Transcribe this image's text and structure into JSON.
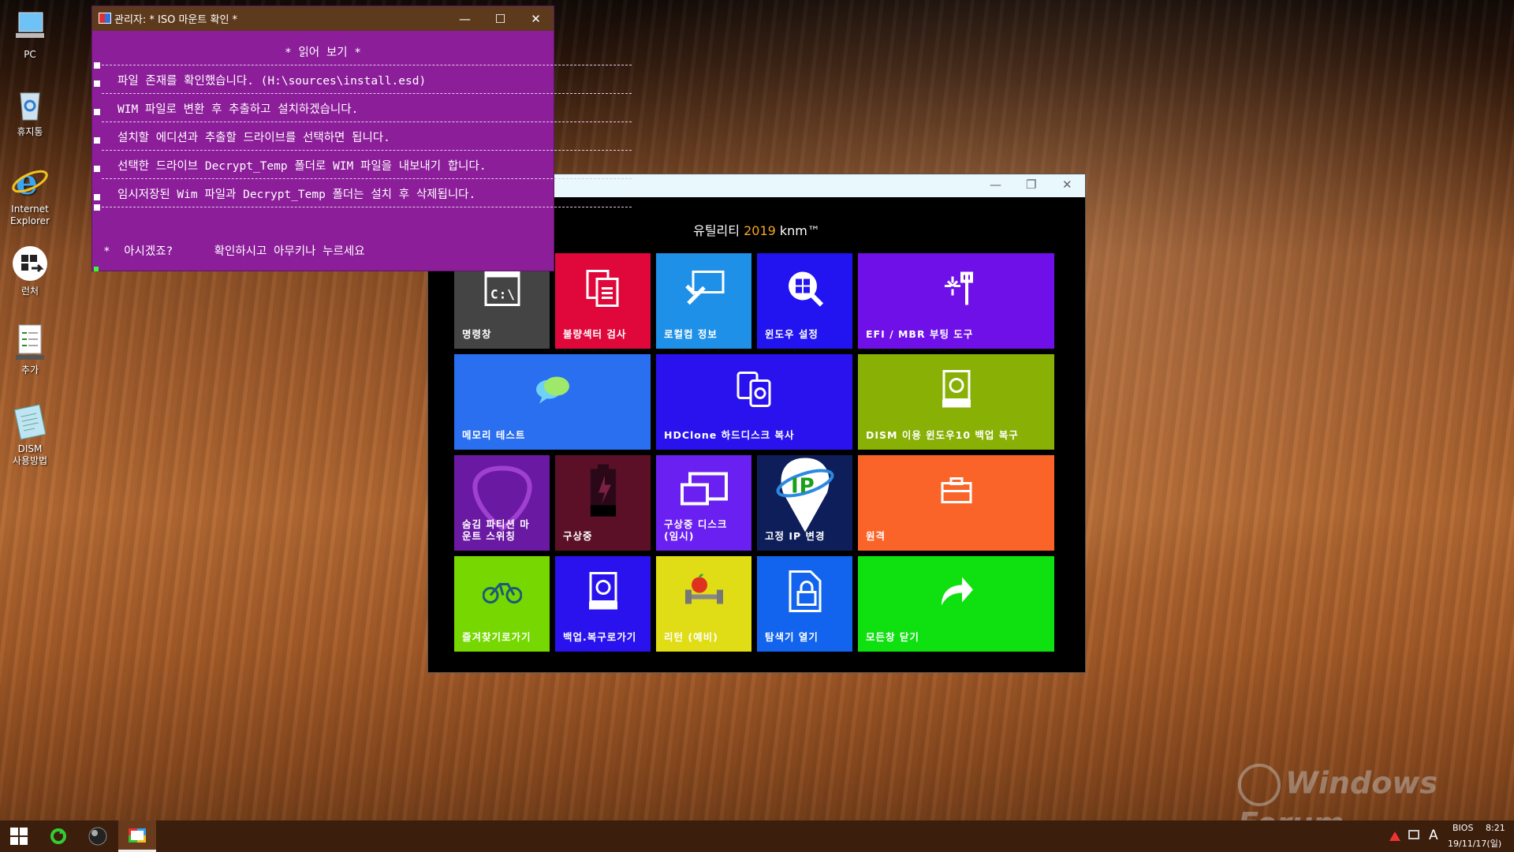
{
  "desktop": {
    "icons": [
      {
        "label": "PC",
        "icon": "pc-icon"
      },
      {
        "label": "휴지통",
        "icon": "recycle-bin-icon"
      },
      {
        "label": "Internet\nExplorer",
        "icon": "internet-explorer-icon"
      },
      {
        "label": "런처",
        "icon": "launcher-icon"
      },
      {
        "label": "추가",
        "icon": "add-document-icon"
      },
      {
        "label": "DISM\n사용방법",
        "icon": "notepad-icon"
      }
    ]
  },
  "cmd_window": {
    "title": "관리자:    * ISO 마운트 확인 *",
    "heading": "* 읽어 보기 *",
    "lines": [
      "파일 존재를 확인했습니다. (H:\\sources\\install.esd)",
      "WIM 파일로 변환 후 추출하고 설치하겠습니다.",
      "설치할 에디션과 추출할 드라이브를 선택하면 됩니다.",
      "선택한 드라이브 Decrypt_Temp 폴더로 WIM 파일을 내보내기 합니다.",
      "임시저장된 Wim 파일과 Decrypt_Temp 폴더는 설치 후 삭제됩니다."
    ],
    "prompt": "*  아시겠죠?      확인하시고 아무키나 누르세요",
    "colors": {
      "background": "#8c1e9a",
      "titlebar": "#5d3a1c"
    }
  },
  "utility_window": {
    "title_prefix": "유틸리티 ",
    "title_year": "2019",
    "title_suffix": " knm™",
    "tiles": [
      {
        "label": "명령창",
        "color": "#444444",
        "icon": "command-prompt-icon"
      },
      {
        "label": "불량섹터 검사",
        "color": "#e0083b",
        "icon": "documents-icon"
      },
      {
        "label": "로컬컴 정보",
        "color": "#1e90e8",
        "icon": "tools-monitor-icon"
      },
      {
        "label": "윈도우 설정",
        "color": "#2214f0",
        "icon": "windows-search-icon"
      },
      {
        "label": "EFI / MBR 부팅 도구",
        "color": "#7010e8",
        "icon": "wrench-spark-icon"
      },
      {
        "label": "메모리 테스트",
        "color": "#2a6ff0",
        "icon": "chat-bubbles-icon"
      },
      {
        "label": "HDClone 하드디스크 복사",
        "color": "#2a12ee",
        "icon": "disk-copy-icon"
      },
      {
        "label": "DISM 이용 윈도우10 백업 복구",
        "color": "#88b005",
        "icon": "backup-drive-icon"
      },
      {
        "label": "숨김 파티션 마\n운트 스위칭",
        "color": "#6a1aa2",
        "icon": "guitar-pick-icon"
      },
      {
        "label": "구상중",
        "color": "#5c1028",
        "icon": "battery-icon"
      },
      {
        "label": "구상중 디스크\n(임시)",
        "color": "#6a20f0",
        "icon": "cast-screen-icon"
      },
      {
        "label": "고정 IP 변경",
        "color": "#0e1e5a",
        "icon": "ip-pin-icon"
      },
      {
        "label": "원격",
        "color": "#fb6429",
        "icon": "toolbox-icon"
      },
      {
        "label": "즐겨찾기로가기",
        "color": "#76d800",
        "icon": "bicycle-icon"
      },
      {
        "label": "백업.복구로가기",
        "color": "#2a12ee",
        "icon": "restore-drive-icon"
      },
      {
        "label": "리턴 (예비)",
        "color": "#e0dc16",
        "icon": "dumbbell-apple-icon"
      },
      {
        "label": "탐색기 열기",
        "color": "#1264ee",
        "icon": "lock-file-icon"
      },
      {
        "label": "모든창 닫기",
        "color": "#0fe010",
        "icon": "share-arrow-icon"
      }
    ]
  },
  "taskbar": {
    "items": [
      "start-icon",
      "refresh-icon",
      "orb-icon",
      "admin-window-icon"
    ],
    "tray": {
      "ime": "A",
      "bios": "BIOS",
      "time": "8:21",
      "date": "19/11/17(일)"
    }
  },
  "watermark": "Windows Forum"
}
